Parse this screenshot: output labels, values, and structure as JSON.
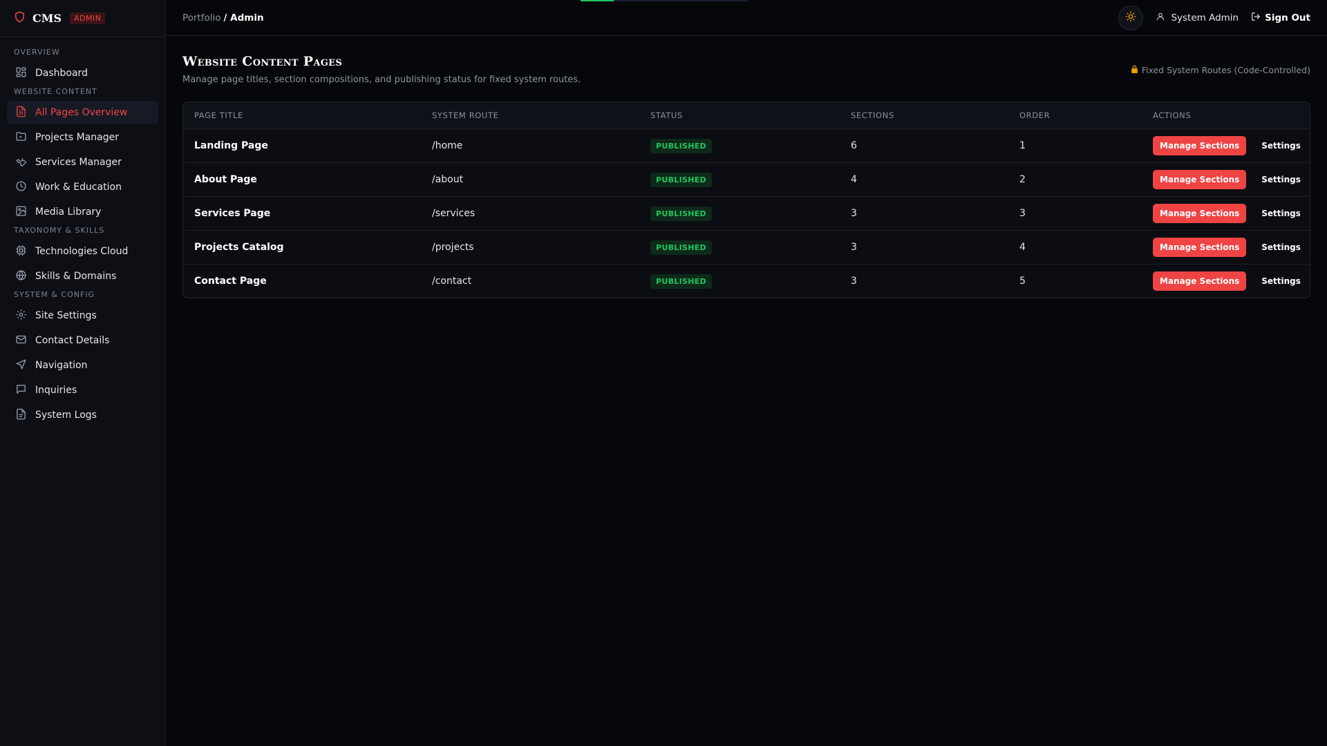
{
  "brand": {
    "name": "CMS",
    "badge": "ADMIN"
  },
  "sidebar": {
    "groups": [
      {
        "label": "Overview",
        "items": [
          {
            "label": "Dashboard",
            "icon": "dashboard-icon"
          }
        ]
      },
      {
        "label": "Website Content",
        "items": [
          {
            "label": "All Pages Overview",
            "icon": "file-text-icon",
            "active": true
          },
          {
            "label": "Projects Manager",
            "icon": "folder-icon"
          },
          {
            "label": "Services Manager",
            "icon": "wrench-icon"
          },
          {
            "label": "Work & Education",
            "icon": "clock-icon"
          },
          {
            "label": "Media Library",
            "icon": "image-icon"
          }
        ]
      },
      {
        "label": "Taxonomy & Skills",
        "items": [
          {
            "label": "Technologies Cloud",
            "icon": "cpu-icon"
          },
          {
            "label": "Skills & Domains",
            "icon": "globe-icon"
          }
        ]
      },
      {
        "label": "System & Config",
        "items": [
          {
            "label": "Site Settings",
            "icon": "gear-icon"
          },
          {
            "label": "Contact Details",
            "icon": "mail-icon"
          },
          {
            "label": "Navigation",
            "icon": "navigation-icon"
          },
          {
            "label": "Inquiries",
            "icon": "message-icon"
          },
          {
            "label": "System Logs",
            "icon": "log-icon"
          }
        ]
      }
    ]
  },
  "header": {
    "breadcrumb_root": "Portfolio",
    "breadcrumb_current": "/ Admin",
    "user_label": "System Admin",
    "signout_label": "Sign Out"
  },
  "page": {
    "title": "Website Content Pages",
    "subtitle": "Manage page titles, section compositions, and publishing status for fixed system routes.",
    "fixed_note": "Fixed System Routes (Code-Controlled)"
  },
  "table": {
    "columns": [
      "Page Title",
      "System Route",
      "Status",
      "Sections",
      "Order",
      "Actions"
    ],
    "rows": [
      {
        "title": "Landing Page",
        "route": "/home",
        "status": "PUBLISHED",
        "sections": "6",
        "order": "1"
      },
      {
        "title": "About Page",
        "route": "/about",
        "status": "PUBLISHED",
        "sections": "4",
        "order": "2"
      },
      {
        "title": "Services Page",
        "route": "/services",
        "status": "PUBLISHED",
        "sections": "3",
        "order": "3"
      },
      {
        "title": "Projects Catalog",
        "route": "/projects",
        "status": "PUBLISHED",
        "sections": "3",
        "order": "4"
      },
      {
        "title": "Contact Page",
        "route": "/contact",
        "status": "PUBLISHED",
        "sections": "3",
        "order": "5"
      }
    ],
    "manage_label": "Manage Sections",
    "settings_label": "Settings"
  },
  "colors": {
    "accent": "#ef4444",
    "success": "#22c55e",
    "background": "#06070a",
    "sidebar": "#0d0f14",
    "lock": "#f59e0b",
    "sun": "#f59e0b"
  }
}
